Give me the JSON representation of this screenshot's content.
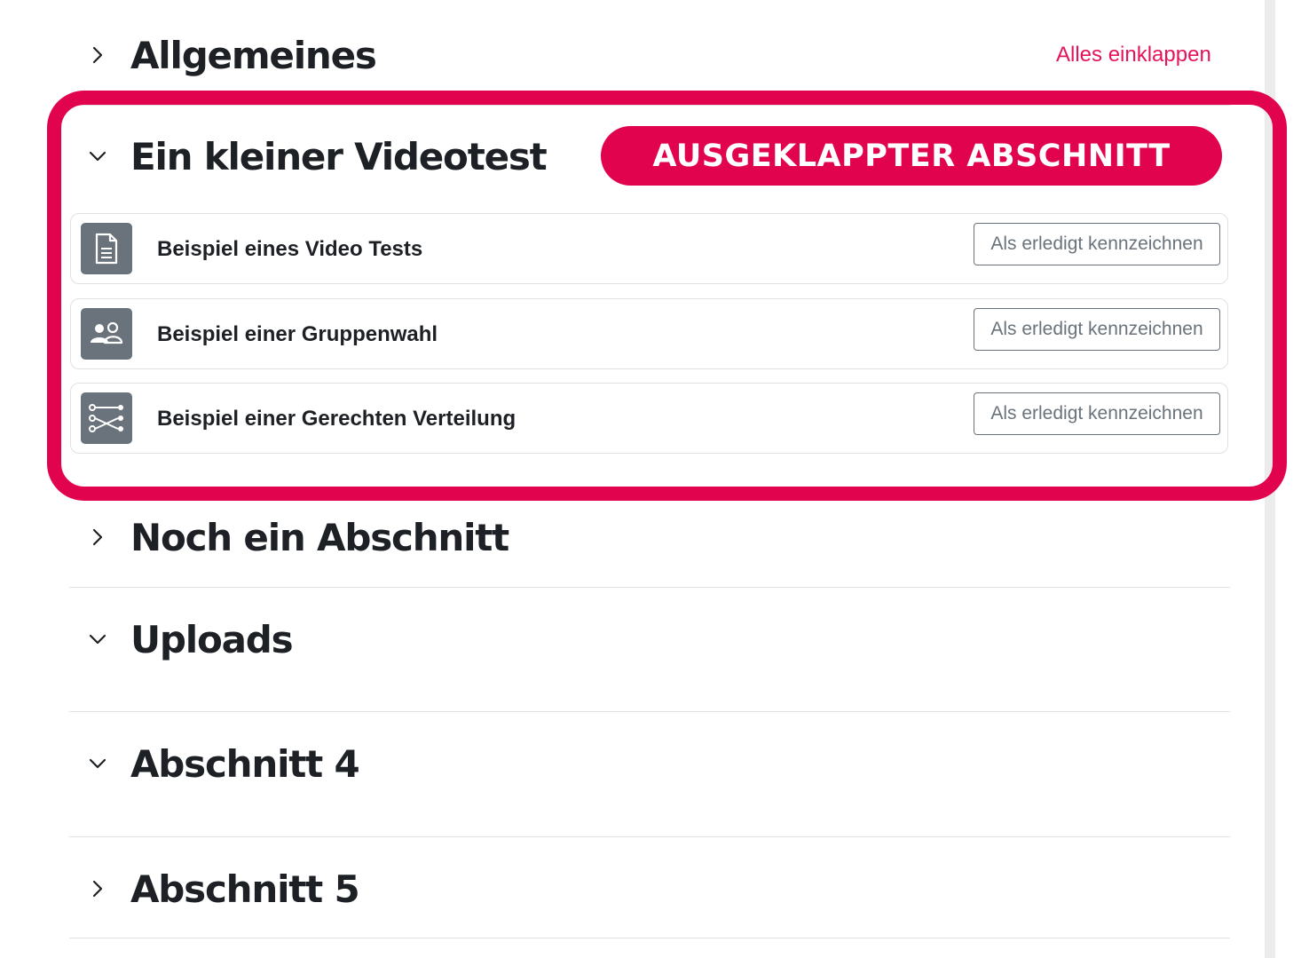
{
  "header": {
    "collapse_all_label": "Alles einklappen"
  },
  "annotation": {
    "badge_text": "AUSGEKLAPPTER ABSCHNITT",
    "color": "#e2034f"
  },
  "sections": [
    {
      "title": "Allgemeines",
      "state": "collapsed",
      "icon": "chevron-right-icon"
    },
    {
      "title": "Ein kleiner Videotest",
      "state": "expanded",
      "icon": "chevron-down-icon",
      "activities": [
        {
          "name": "Beispiel eines Video Tests",
          "icon": "document-icon",
          "button_label": "Als erledigt kennzeichnen"
        },
        {
          "name": "Beispiel einer Gruppenwahl",
          "icon": "group-choice-icon",
          "button_label": "Als erledigt kennzeichnen"
        },
        {
          "name": "Beispiel einer Gerechten Verteilung",
          "icon": "fair-allocation-icon",
          "button_label": "Als erledigt kennzeichnen"
        }
      ]
    },
    {
      "title": "Noch ein Abschnitt",
      "state": "collapsed",
      "icon": "chevron-right-icon"
    },
    {
      "title": "Uploads",
      "state": "expanded",
      "icon": "chevron-down-icon"
    },
    {
      "title": "Abschnitt 4",
      "state": "expanded",
      "icon": "chevron-down-icon"
    },
    {
      "title": "Abschnitt 5",
      "state": "collapsed",
      "icon": "chevron-right-icon"
    }
  ],
  "colors": {
    "accent": "#e5135a",
    "text": "#1d2125",
    "icon_bg": "#6a737b",
    "border": "#dee2e6"
  }
}
